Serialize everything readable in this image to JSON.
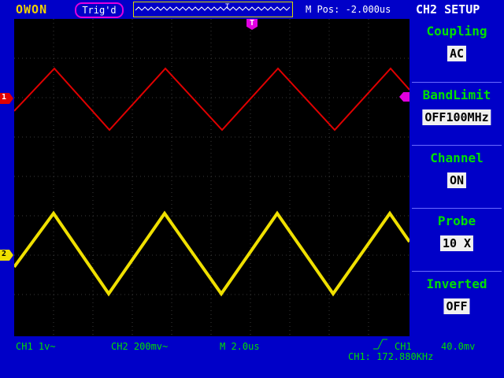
{
  "header": {
    "brand": "OWON",
    "trigger_status": "Trig'd",
    "m_pos": "M Pos: -2.000us",
    "menu_title": "CH2 SETUP"
  },
  "menu": [
    {
      "label": "Coupling",
      "value": "AC"
    },
    {
      "label": "BandLimit",
      "value": "OFF100MHz"
    },
    {
      "label": "Channel",
      "value": "ON"
    },
    {
      "label": "Probe",
      "value": "10 X"
    },
    {
      "label": "Inverted",
      "value": "OFF"
    }
  ],
  "status": {
    "ch1_scale": "CH1 1v~",
    "ch2_scale": "CH2 200mv~",
    "time_base": "M  2.0us",
    "trigger_source": "CH1",
    "trigger_level": "40.0mv",
    "frequency": "CH1: 172.880KHz"
  },
  "markers": {
    "ch1": "1",
    "ch2": "2",
    "trigger": "T"
  },
  "colors": {
    "ch1": "#f0e000",
    "ch2": "#e00000",
    "accent": "#00e000",
    "background": "#0000c8"
  }
}
